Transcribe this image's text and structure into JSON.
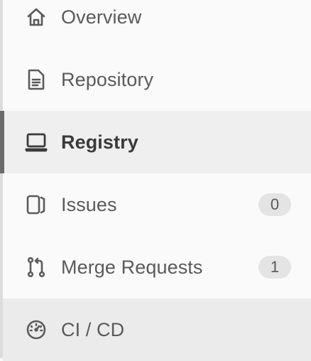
{
  "sidebar": {
    "items": [
      {
        "label": "Overview",
        "icon": "home-icon",
        "badge": null
      },
      {
        "label": "Repository",
        "icon": "document-icon",
        "badge": null
      },
      {
        "label": "Registry",
        "icon": "laptop-icon",
        "badge": null,
        "active": true
      },
      {
        "label": "Issues",
        "icon": "issues-icon",
        "badge": "0"
      },
      {
        "label": "Merge Requests",
        "icon": "merge-request-icon",
        "badge": "1"
      },
      {
        "label": "CI / CD",
        "icon": "gauge-icon",
        "badge": null,
        "hovered": true
      }
    ]
  },
  "colors": {
    "background": "#fafafa",
    "active_background": "#efefef",
    "active_bar": "#6b6b6b",
    "hover_background": "#ebebeb",
    "text": "#5a5a5a",
    "badge_background": "#e4e4e4"
  }
}
